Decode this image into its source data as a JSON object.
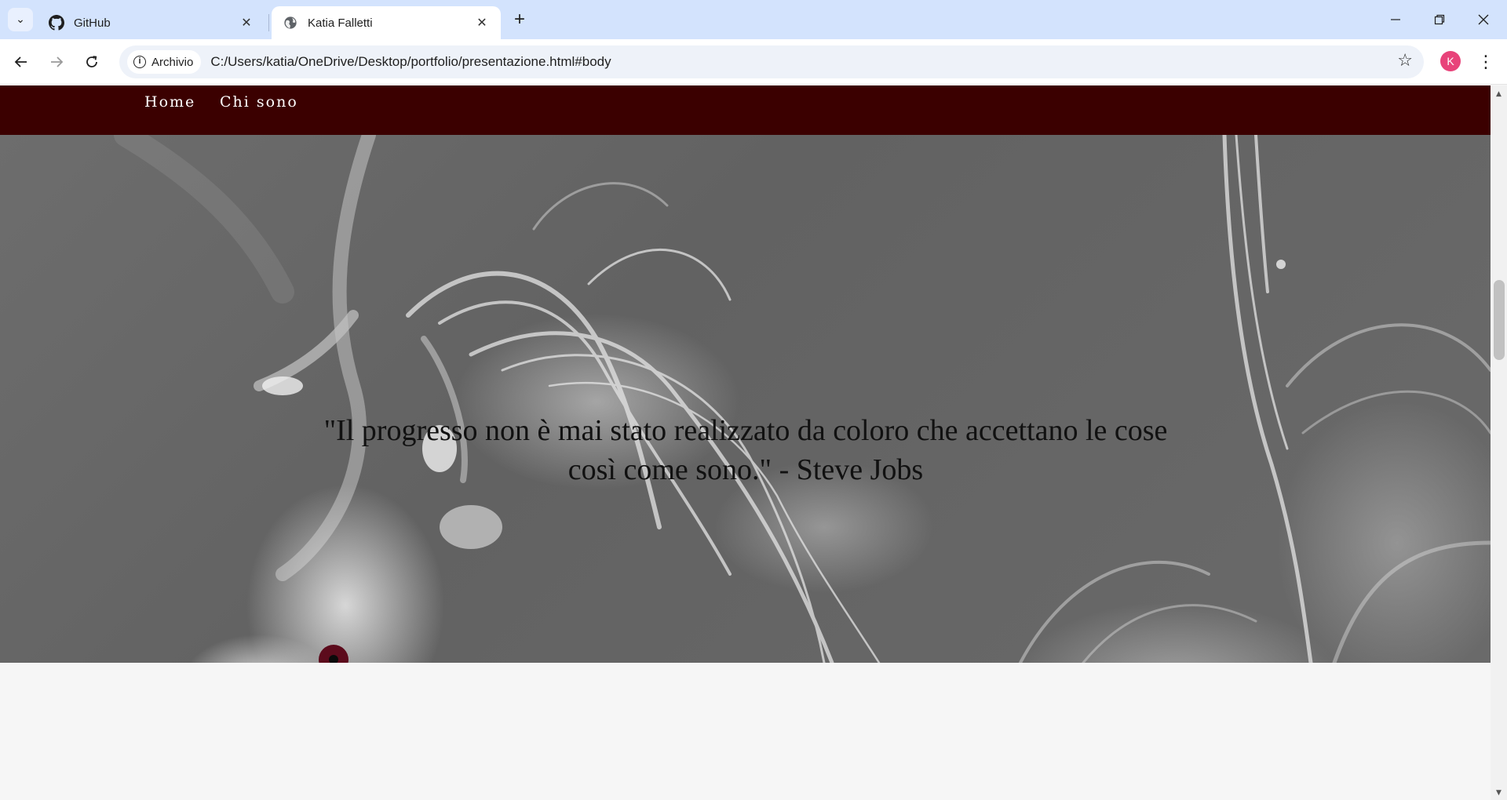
{
  "browser": {
    "tabs": [
      {
        "title": "GitHub",
        "icon": "github-icon",
        "active": false
      },
      {
        "title": "Katia Falletti",
        "icon": "globe-icon",
        "active": true
      }
    ],
    "new_tab_icon": "+",
    "address": {
      "security_chip": "Archivio",
      "url": "C:/Users/katia/OneDrive/Desktop/portfolio/presentazione.html#body"
    },
    "profile_initial": "K",
    "profile_color": "#e8437a"
  },
  "page": {
    "nav": {
      "background": "#3b0000",
      "items": [
        "Home",
        "Chi sono"
      ]
    },
    "hero": {
      "quote": "\"Il progresso non è mai stato realizzato da coloro che accettano le cose così come sono.\" - Steve Jobs"
    },
    "accent_color": "#5c0b1c"
  }
}
